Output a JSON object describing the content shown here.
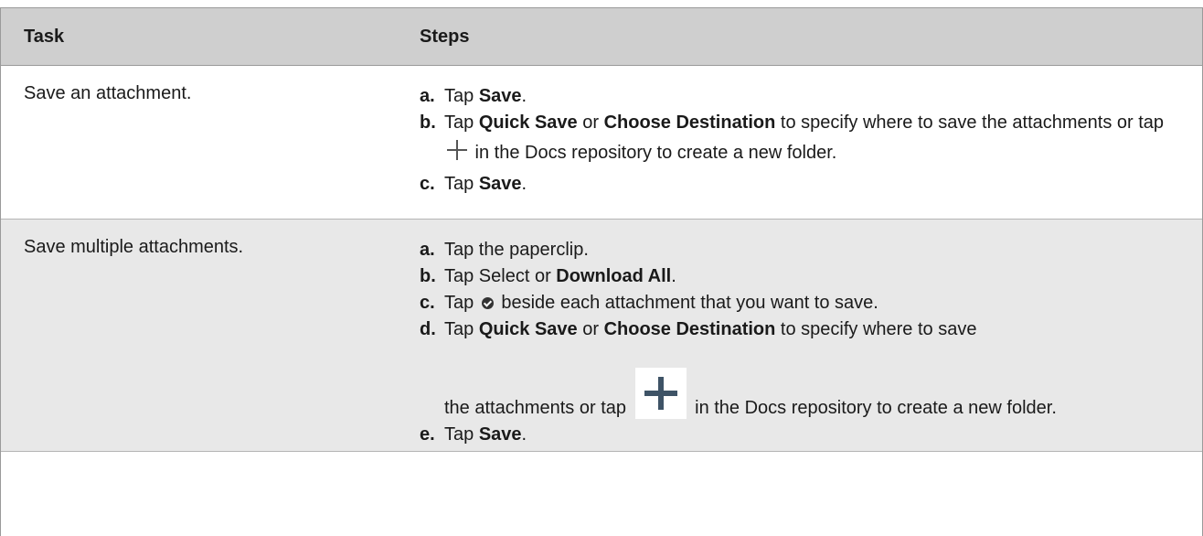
{
  "table": {
    "headers": {
      "task": "Task",
      "steps": "Steps"
    },
    "rows": [
      {
        "task": "Save an attachment.",
        "steps": {
          "a": {
            "letter": "a.",
            "t1": "Tap ",
            "b1": "Save",
            "t2": "."
          },
          "b": {
            "letter": "b.",
            "t1": "Tap ",
            "b1": "Quick Save",
            "t2": " or ",
            "b2": "Choose Destination",
            "t3": " to specify where to save the attachments or tap ",
            "t4": " in the Docs repository to create a new folder."
          },
          "c": {
            "letter": "c.",
            "t1": "Tap ",
            "b1": "Save",
            "t2": "."
          }
        }
      },
      {
        "task": "Save multiple attachments.",
        "steps": {
          "a": {
            "letter": "a.",
            "t1": "Tap the paperclip."
          },
          "b": {
            "letter": "b.",
            "t1": "Tap Select or ",
            "b1": "Download All",
            "t2": "."
          },
          "c": {
            "letter": "c.",
            "t1": "Tap ",
            "t2": " beside each attachment that you want to save."
          },
          "d": {
            "letter": "d.",
            "t1": "Tap ",
            "b1": "Quick Save",
            "t2": " or ",
            "b2": "Choose Destination",
            "t3": " to specify where to save",
            "t4": "the attachments or tap ",
            "t5": " in the Docs repository to create a new folder."
          },
          "e": {
            "letter": "e.",
            "t1": "Tap ",
            "b1": "Save",
            "t2": "."
          }
        }
      }
    ],
    "icons": {
      "plus": "plus-icon",
      "check": "check-circle-icon"
    }
  }
}
